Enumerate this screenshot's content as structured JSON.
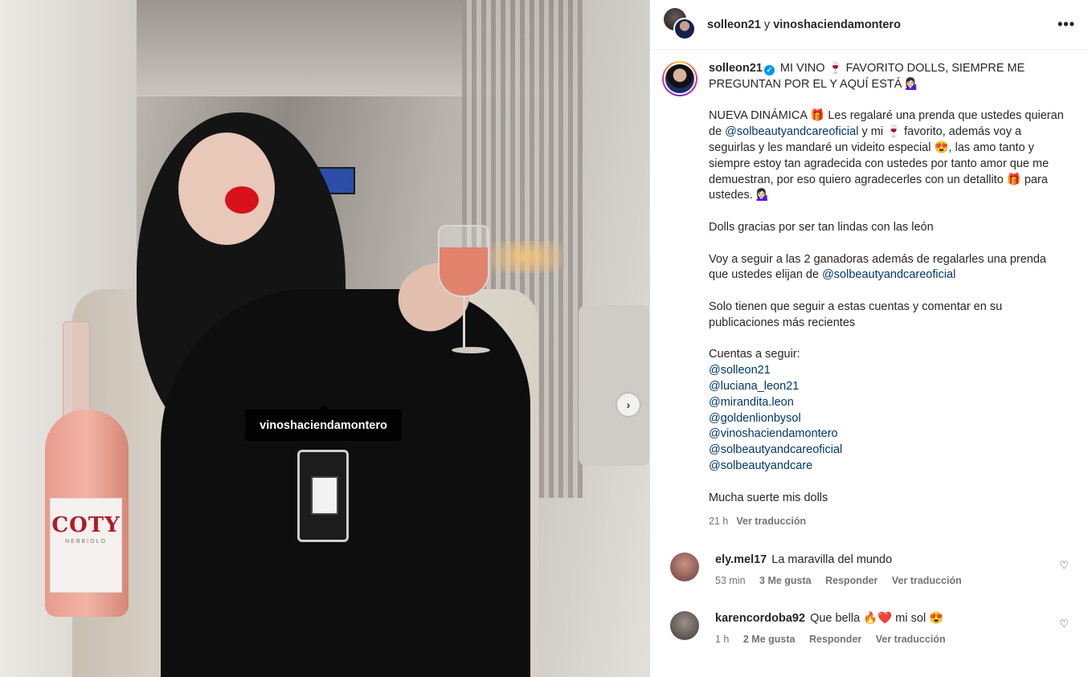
{
  "media": {
    "tag_user": "vinoshaciendamontero",
    "bottle_brand": "COTY",
    "bottle_sub": "NEBBIOLO",
    "next_icon": "›"
  },
  "header": {
    "user1": "solleon21",
    "and": " y ",
    "user2": "vinoshaciendamontero",
    "more_icon": "•••"
  },
  "caption": {
    "username": "solleon21",
    "verified_icon": "✓",
    "line1": "MI VINO 🍷 FAVORITO DOLLS, SIEMPRE ME PREGUNTAN POR EL Y AQUÍ ESTÁ 💁🏻‍♀️",
    "p2_a": "NUEVA DINÁMICA 🎁 Les regalaré una prenda que ustedes quieran de ",
    "p2_link": "@solbeautyandcareoficial",
    "p2_b": " y mi 🍷 favorito, además voy a seguirlas y les mandaré un videito especial 😍, las amo tanto y siempre estoy tan agradecida con ustedes por tanto amor que me demuestran, por eso quiero agradecerles con un detallito 🎁 para ustedes. 💁🏻‍♀️",
    "p3": "Dolls gracias por ser tan lindas con las león",
    "p4_a": "Voy a seguir a las 2 ganadoras además de regalarles una prenda que ustedes elijan de ",
    "p4_link": "@solbeautyandcareoficial",
    "p5": "Solo tienen que seguir a estas cuentas y comentar en su publicaciones más recientes",
    "follow_title": "Cuentas a seguir:",
    "mentions": [
      "@solleon21",
      "@luciana_leon21",
      "@mirandita.leon",
      "@goldenlionbysol",
      "@vinoshaciendamontero",
      "@solbeautyandcareoficial",
      "@solbeautyandcare"
    ],
    "closing": "Mucha suerte mis dolls",
    "time": "21 h",
    "translate": "Ver traducción"
  },
  "comments": [
    {
      "username": "ely.mel17",
      "text": "La maravilla del mundo",
      "time": "53 min",
      "likes": "3 Me gusta",
      "reply": "Responder",
      "translate": "Ver traducción",
      "avatar_color": "#b0746a"
    },
    {
      "username": "karencordoba92",
      "text": "Que bella 🔥❤️ mi sol 😍",
      "time": "1 h",
      "likes": "2 Me gusta",
      "reply": "Responder",
      "translate": "Ver traducción",
      "avatar_color": "#6d6a66"
    }
  ],
  "icons": {
    "heart": "♡"
  }
}
